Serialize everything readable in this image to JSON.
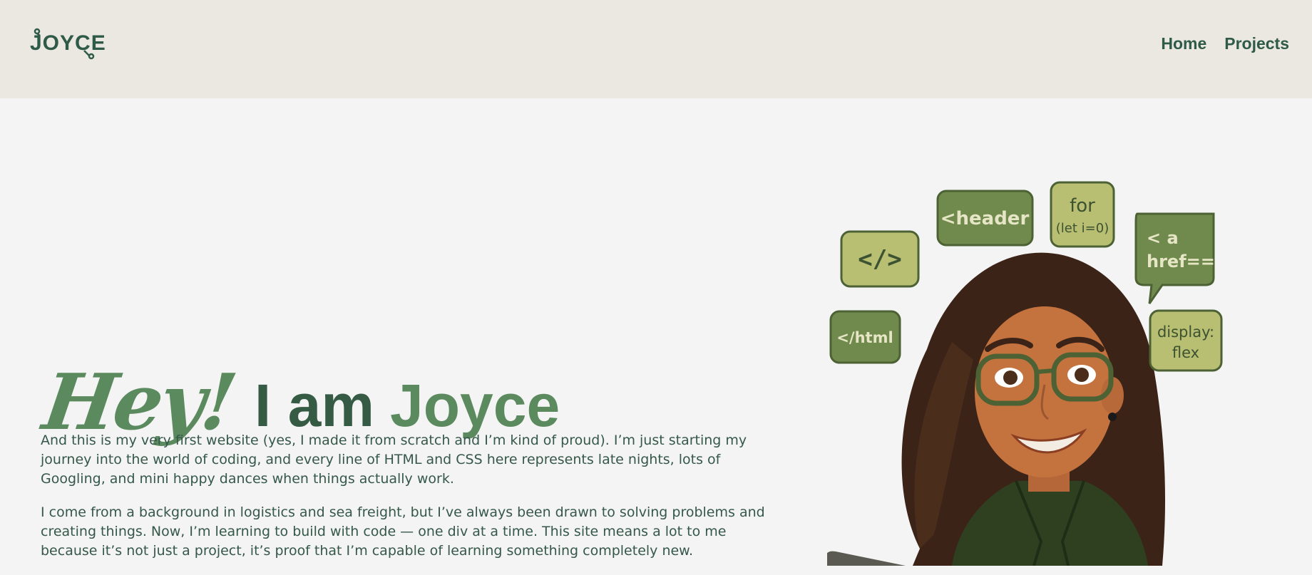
{
  "header": {
    "logo_text": "JOYCE",
    "nav": [
      {
        "label": "Home"
      },
      {
        "label": "Projects"
      }
    ]
  },
  "hero": {
    "greeting": "Hey!",
    "intro_prefix": "I am",
    "name": "Joyce",
    "paragraphs": [
      "And this is my very first website (yes, I made it from scratch and I’m kind of proud). I’m just starting my journey into the world of coding, and every line of HTML and CSS here represents late nights, lots of Googling, and mini happy dances when things actually work.",
      "I come from a background in logistics and sea freight, but I’ve always been drawn to solving problems and creating things. Now, I’m learning to build with code — one div at a time. This site means a lot to me because it’s not just a project, it’s proof that I’m capable of learning something completely new."
    ]
  },
  "illustration": {
    "bubbles": {
      "tag": "</>",
      "header": "<header",
      "for_line1": "for",
      "for_line2": "(let i=0)",
      "href_line1": "< a",
      "href_line2": "href==",
      "html": "</html",
      "display_line1": "display:",
      "display_line2": "flex"
    }
  },
  "colors": {
    "nav_bg": "#ebe8e2",
    "page_bg": "#f4f4f4",
    "dark_green": "#2f5a47",
    "accent_green": "#5b8a5e",
    "bubble_dark": "#6f8a4c",
    "bubble_light": "#b8bf72"
  }
}
